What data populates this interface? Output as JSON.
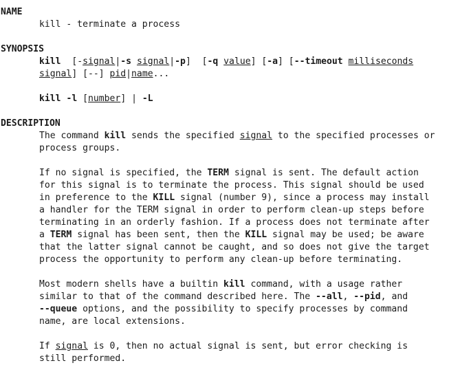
{
  "man_page": {
    "name_section": {
      "heading": "NAME",
      "text": "kill - terminate a process"
    },
    "synopsis_section": {
      "heading": "SYNOPSIS",
      "line1": {
        "cmd": "kill",
        "t1": "  [-",
        "signal_u1": "signal",
        "t2": "|",
        "opt_s": "-s",
        "t3": " ",
        "signal_u2": "signal",
        "t4": "|",
        "opt_p": "-p",
        "t5": "]  [",
        "opt_q": "-q",
        "t6": " ",
        "value_u": "value",
        "t7": "] [",
        "opt_a": "-a",
        "t8": "] [",
        "opt_timeout": "--timeout",
        "t9": " ",
        "ms_u": "milliseconds"
      },
      "line2": {
        "signal_u": "signal",
        "t1": "] [--] ",
        "pid_u": "pid",
        "t2": "|",
        "name_u": "name",
        "t3": "..."
      },
      "line3": {
        "cmd": "kill",
        "t1": " ",
        "opt_l": "-l",
        "t2": " [",
        "number_u": "number",
        "t3": "] | ",
        "opt_L": "-L"
      }
    },
    "description_section": {
      "heading": "DESCRIPTION",
      "p1": {
        "l1_a": "The command ",
        "l1_kill": "kill",
        "l1_b": " sends the specified ",
        "l1_signal": "signal",
        "l1_c": " to the specified processes or",
        "l2": "process groups."
      },
      "p2": {
        "l1_a": "If no signal is specified, the ",
        "l1_term": "TERM",
        "l1_b": " signal is sent. The default action",
        "l2": "for this signal is to terminate the process. This signal should be used",
        "l3_a": "in preference to the ",
        "l3_kill": "KILL",
        "l3_b": " signal (number 9), since a process may install",
        "l4": "a handler for the TERM signal in order to perform clean-up steps before",
        "l5": "terminating in an orderly fashion. If a process does not terminate after",
        "l6_a": "a ",
        "l6_term": "TERM",
        "l6_b": " signal has been sent, then the ",
        "l6_kill": "KILL",
        "l6_c": " signal may be used; be aware",
        "l7": "that the latter signal cannot be caught, and so does not give the target",
        "l8": "process the opportunity to perform any clean-up before terminating."
      },
      "p3": {
        "l1_a": "Most modern shells have a builtin ",
        "l1_kill": "kill",
        "l1_b": " command, with a usage rather",
        "l2_a": "similar to that of the command described here. The ",
        "l2_all": "--all",
        "l2_b": ", ",
        "l2_pid": "--pid",
        "l2_c": ", and",
        "l3_queue": "--queue",
        "l3_a": " options, and the possibility to specify processes by command",
        "l4": "name, are local extensions."
      },
      "p4": {
        "l1_a": "If ",
        "l1_signal": "signal",
        "l1_b": " is 0, then no actual signal is sent, but error checking is",
        "l2": "still performed."
      }
    }
  }
}
